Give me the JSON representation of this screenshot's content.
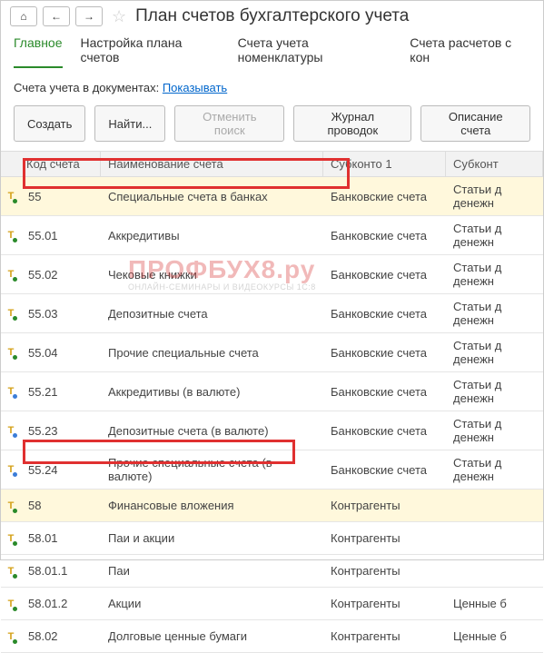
{
  "title": "План счетов бухгалтерского учета",
  "tabs": [
    "Главное",
    "Настройка плана счетов",
    "Счета учета номенклатуры",
    "Счета расчетов с кон"
  ],
  "subline_label": "Счета учета в документах:",
  "subline_link": "Показывать",
  "buttons": {
    "create": "Создать",
    "find": "Найти...",
    "cancel_search": "Отменить поиск",
    "journal": "Журнал проводок",
    "describe": "Описание счета"
  },
  "columns": {
    "code": "Код счета",
    "name": "Наименование счета",
    "sk1": "Субконто 1",
    "sk2": "Субконт"
  },
  "rows": [
    {
      "code": "55",
      "name": "Специальные счета в банках",
      "sk1": "Банковские счета",
      "sk2": "Статьи д денежн",
      "hl": true,
      "tall": true,
      "blue": false
    },
    {
      "code": "55.01",
      "name": "Аккредитивы",
      "sk1": "Банковские счета",
      "sk2": "Статьи д денежн",
      "hl": false,
      "tall": true,
      "blue": false
    },
    {
      "code": "55.02",
      "name": "Чековые книжки",
      "sk1": "Банковские счета",
      "sk2": "Статьи д денежн",
      "hl": false,
      "tall": true,
      "blue": false
    },
    {
      "code": "55.03",
      "name": "Депозитные счета",
      "sk1": "Банковские счета",
      "sk2": "Статьи д денежн",
      "hl": false,
      "tall": true,
      "blue": false
    },
    {
      "code": "55.04",
      "name": "Прочие специальные счета",
      "sk1": "Банковские счета",
      "sk2": "Статьи д денежн",
      "hl": false,
      "tall": true,
      "blue": false
    },
    {
      "code": "55.21",
      "name": "Аккредитивы (в валюте)",
      "sk1": "Банковские счета",
      "sk2": "Статьи д денежн",
      "hl": false,
      "tall": true,
      "blue": true
    },
    {
      "code": "55.23",
      "name": "Депозитные счета (в валюте)",
      "sk1": "Банковские счета",
      "sk2": "Статьи д денежн",
      "hl": false,
      "tall": true,
      "blue": true
    },
    {
      "code": "55.24",
      "name": "Прочие специальные счета (в валюте)",
      "sk1": "Банковские счета",
      "sk2": "Статьи д денежн",
      "hl": false,
      "tall": true,
      "blue": true
    },
    {
      "code": "58",
      "name": "Финансовые вложения",
      "sk1": "Контрагенты",
      "sk2": "",
      "hl": true,
      "tall": false,
      "blue": false
    },
    {
      "code": "58.01",
      "name": "Паи и акции",
      "sk1": "Контрагенты",
      "sk2": "",
      "hl": false,
      "tall": false,
      "blue": false
    },
    {
      "code": "58.01.1",
      "name": "Паи",
      "sk1": "Контрагенты",
      "sk2": "",
      "hl": false,
      "tall": false,
      "blue": false
    },
    {
      "code": "58.01.2",
      "name": "Акции",
      "sk1": "Контрагенты",
      "sk2": "Ценные б",
      "hl": false,
      "tall": false,
      "blue": false
    },
    {
      "code": "58.02",
      "name": "Долговые ценные бумаги",
      "sk1": "Контрагенты",
      "sk2": "Ценные б",
      "hl": false,
      "tall": false,
      "blue": false
    }
  ],
  "watermark": {
    "line1": "ПРОФБУХ8.ру",
    "line2": "ОНЛАЙН-СЕМИНАРЫ И ВИДЕОКУРСЫ 1С:8"
  }
}
